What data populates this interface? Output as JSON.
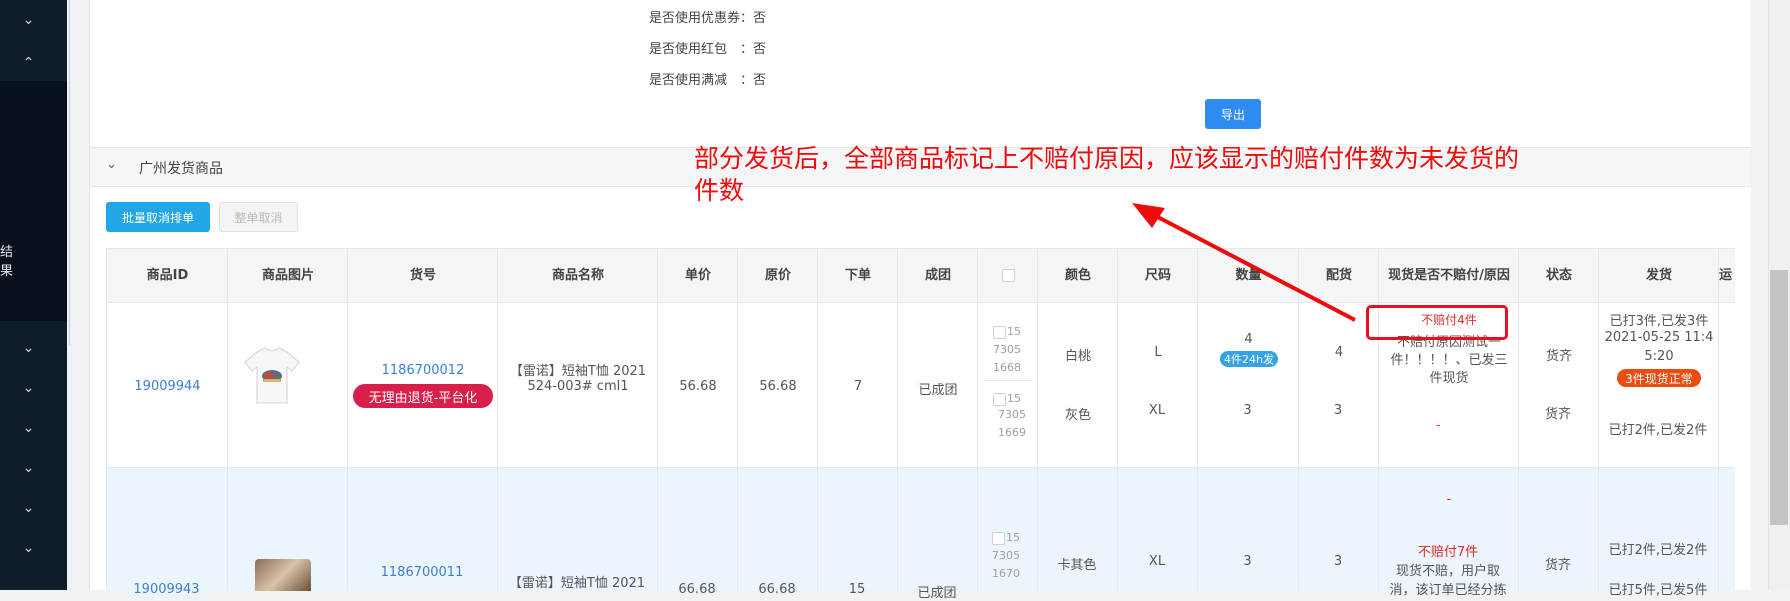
{
  "sidebar": {
    "chevrons": [
      "⌄",
      "⌃",
      "⌄",
      "⌄",
      "⌄",
      "⌄",
      "⌄",
      "⌄"
    ],
    "partial_label": "结果"
  },
  "order_info": {
    "coupon": "是否使用优惠券：否",
    "red_packet": "是否使用红包　：否",
    "full_reduction": "是否使用满减　：否"
  },
  "export_label": "导出",
  "section": {
    "title": "广州发货商品",
    "chevron": "⌄"
  },
  "buttons": {
    "batch_cancel": "批量取消排单",
    "whole_cancel": "整单取消"
  },
  "table": {
    "headers": [
      "商品ID",
      "商品图片",
      "货号",
      "商品名称",
      "单价",
      "原价",
      "下单",
      "成团",
      "",
      "颜色",
      "尺码",
      "数量",
      "配货",
      "现货是否不赔付/原因",
      "状态",
      "发货",
      "运"
    ],
    "rows": [
      {
        "id": "19009944",
        "sku": "1186700012",
        "sku_tag": "无理由退货-平台化",
        "name_l1": "【雷诺】短袖T恤 2021",
        "name_l2": "524-003# cml1",
        "price": "56.68",
        "orig_price": "56.68",
        "orders": "7",
        "group_status": "已成团",
        "sub_items": [
          {
            "code_l1": "15",
            "code_l2": "7305",
            "code_l3": "1668",
            "color": "白桃",
            "size": "L",
            "qty": "4",
            "qty_tag": "4件24h发",
            "alloc": "4",
            "reason_tag": "不赔付4件",
            "reason_l1": "不赔付原因测试一",
            "reason_l2": "件！！！！、已发三",
            "reason_l3": "件现货",
            "status": "货齐",
            "ship_l1": "已打3件,已发3件",
            "ship_l2": "2021-05-25 11:4",
            "ship_l3": "5:20",
            "ship_tag": "3件现货正常"
          },
          {
            "code_l1": "15",
            "code_l2": "7305",
            "code_l3": "1669",
            "color": "灰色",
            "size": "XL",
            "qty": "3",
            "alloc": "3",
            "reason": "-",
            "status": "货齐",
            "ship_l1": "已打2件,已发2件"
          }
        ]
      },
      {
        "id": "19009943",
        "sku": "1186700011",
        "name_l1": "【雷诺】短袖T恤 2021",
        "price": "66.68",
        "orig_price": "66.68",
        "orders": "15",
        "group_status": "已成团",
        "sub_items": [
          {
            "code_l1": "15",
            "code_l2": "7305",
            "code_l3": "1670",
            "color": "卡其色",
            "size": "XL",
            "qty": "3",
            "alloc": "3",
            "reason_dash": "-",
            "reason_tag": "不赔付7件",
            "reason_l1": "现货不赔，用户取",
            "reason_l2": "消，该订单已经分拣",
            "status": "货齐",
            "ship_l1": "已打2件,已发2件",
            "ship_l2": "已打5件,已发5件"
          }
        ]
      }
    ]
  },
  "annotation": {
    "line1": "部分发货后，全部商品标记上不赔付原因，应该显示的赔付件数为未发货的",
    "line2": "件数"
  },
  "colors": {
    "sidebar_bg": "#0f1c2c",
    "primary_blue": "#2e8bf0",
    "annotation_red": "#f00a0a",
    "row_hover": "#ebf5fc"
  }
}
